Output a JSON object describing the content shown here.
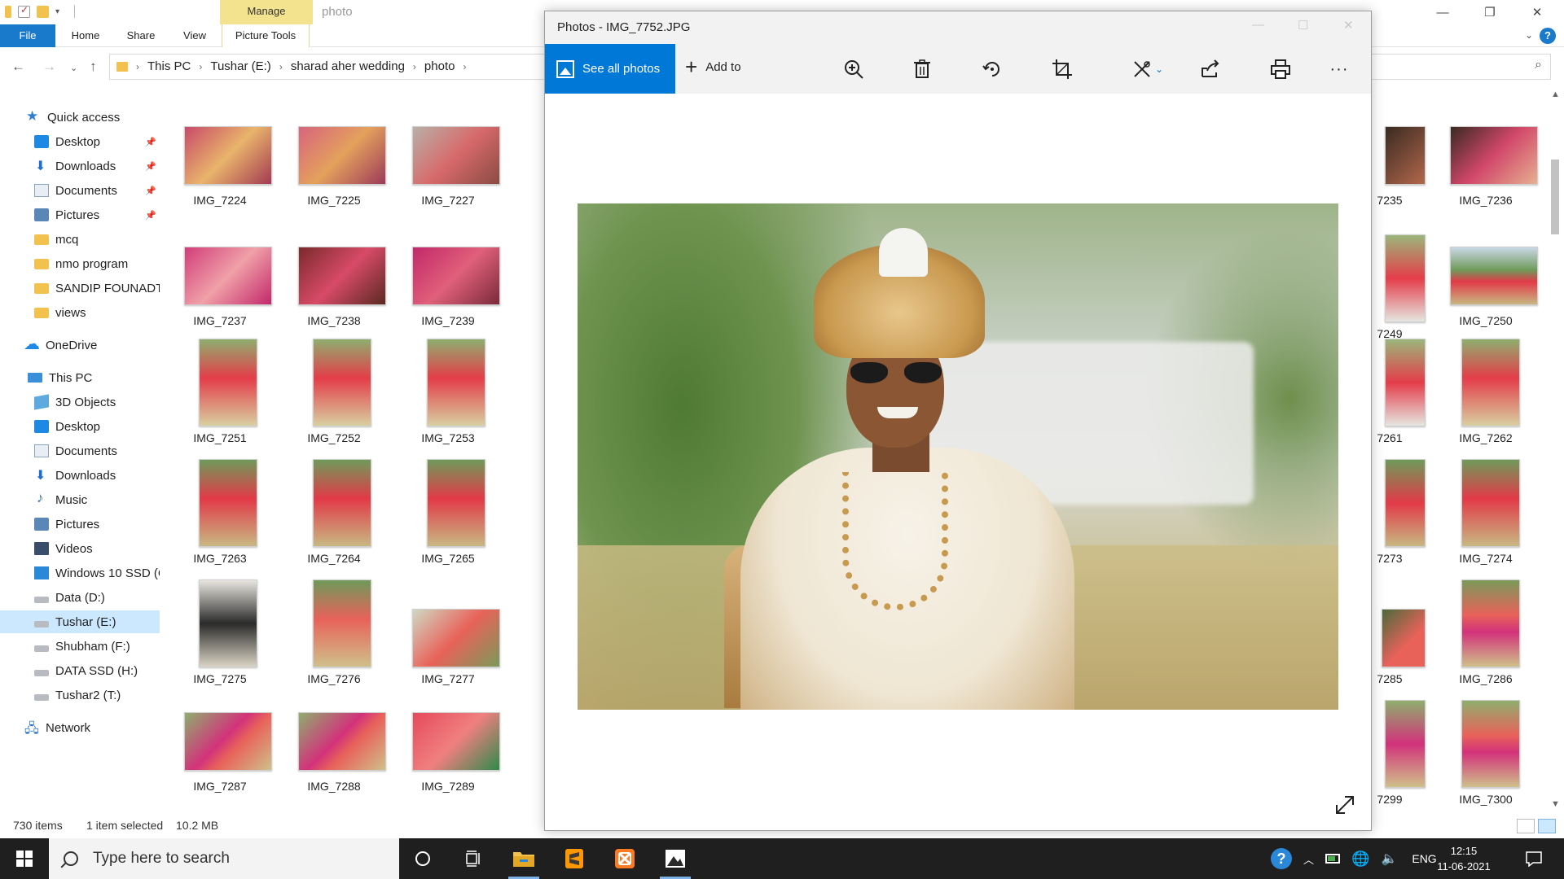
{
  "explorer": {
    "context_tab": "Manage",
    "window_title": "photo",
    "ribbon_tabs": [
      "File",
      "Home",
      "Share",
      "View",
      "Picture Tools"
    ],
    "breadcrumb": [
      "This PC",
      "Tushar (E:)",
      "sharad aher wedding",
      "photo"
    ],
    "nav": {
      "quick_access": "Quick access",
      "quick_items": [
        "Desktop",
        "Downloads",
        "Documents",
        "Pictures",
        "mcq",
        "nmo program",
        "SANDIP FOUNADTI",
        "views"
      ],
      "onedrive": "OneDrive",
      "this_pc": "This PC",
      "pc_items": [
        "3D Objects",
        "Desktop",
        "Documents",
        "Downloads",
        "Music",
        "Pictures",
        "Videos",
        "Windows 10 SSD (C",
        "Data (D:)",
        "Tushar (E:)",
        "Shubham (F:)",
        "DATA SSD (H:)",
        "Tushar2 (T:)"
      ],
      "network": "Network"
    },
    "files": [
      [
        "IMG_7224",
        "IMG_7225",
        "IMG_7227",
        "7235",
        "IMG_7236"
      ],
      [
        "IMG_7237",
        "IMG_7238",
        "IMG_7239",
        "7249",
        "IMG_7250"
      ],
      [
        "IMG_7251",
        "IMG_7252",
        "IMG_7253",
        "7261",
        "IMG_7262"
      ],
      [
        "IMG_7263",
        "IMG_7264",
        "IMG_7265",
        "7273",
        "IMG_7274"
      ],
      [
        "IMG_7275",
        "IMG_7276",
        "IMG_7277",
        "7285",
        "IMG_7286"
      ],
      [
        "IMG_7287",
        "IMG_7288",
        "IMG_7289",
        "7299",
        "IMG_7300"
      ]
    ],
    "status": {
      "items": "730 items",
      "selected": "1 item selected",
      "size": "10.2 MB"
    }
  },
  "photos": {
    "title": "Photos - IMG_7752.JPG",
    "see_all": "See all photos",
    "add_to": "Add to",
    "toolbar_icons": [
      "zoom-in-icon",
      "delete-icon",
      "rotate-icon",
      "crop-icon",
      "edit-icon",
      "share-icon",
      "print-icon",
      "more-icon"
    ]
  },
  "taskbar": {
    "search_placeholder": "Type here to search",
    "language": "ENG",
    "time": "12:15",
    "date": "11-06-2021"
  },
  "colors": {
    "accent": "#0078d7",
    "file_tab": "#1979ca",
    "context_tab": "#f4e38e",
    "selected_nav": "#cce8ff",
    "taskbar": "#1f1f1f"
  }
}
